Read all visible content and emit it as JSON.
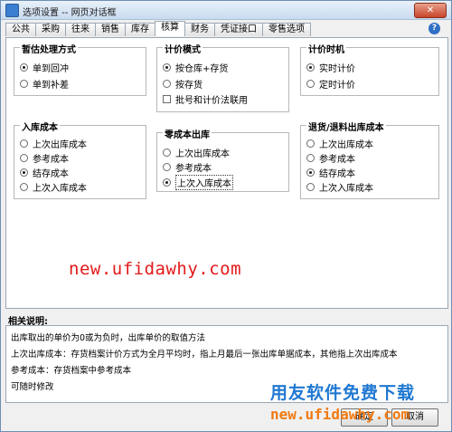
{
  "window": {
    "title": "选项设置 -- 网页对话框",
    "close_label": "✕"
  },
  "tabs": [
    "公共",
    "采购",
    "往来",
    "销售",
    "库存",
    "核算",
    "财务",
    "凭证接口",
    "零售选项"
  ],
  "active_tab": "核算",
  "help_label": "?",
  "groups": {
    "estimate": {
      "title": "暂估处理方式",
      "options": [
        "单到回冲",
        "单到补差"
      ],
      "selected": 0
    },
    "pricing_mode": {
      "title": "计价模式",
      "options": [
        "按仓库+存货",
        "按存货"
      ],
      "selected": 0,
      "checkbox": "批号和计价法联用",
      "checkbox_checked": false
    },
    "pricing_time": {
      "title": "计价时机",
      "options": [
        "实时计价",
        "定时计价"
      ],
      "selected": 0
    },
    "inbound_cost": {
      "title": "入库成本",
      "options": [
        "上次出库成本",
        "参考成本",
        "结存成本",
        "上次入库成本"
      ],
      "selected": 2
    },
    "zero_cost": {
      "title": "零成本出库",
      "options": [
        "上次出库成本",
        "参考成本",
        "上次入库成本"
      ],
      "selected": 2
    },
    "return_cost": {
      "title": "退货/退料出库成本",
      "options": [
        "上次出库成本",
        "参考成本",
        "结存成本",
        "上次入库成本"
      ],
      "selected": 2
    }
  },
  "watermark": "new.ufidawhy.com",
  "description": {
    "label": "相关说明:",
    "lines": [
      "出库取出的单价为0或为负时，出库单价的取值方法",
      "上次出库成本：存货档案计价方式为全月平均时，指上月最后一张出库单据成本，其他指上次出库成本",
      "参考成本：存货档案中参考成本",
      "可随时修改"
    ]
  },
  "buttons": {
    "ok": "确定",
    "cancel": "取消"
  },
  "brand": {
    "line1": "用友软件免费下载",
    "line2": "new.ufidawhy.com"
  }
}
